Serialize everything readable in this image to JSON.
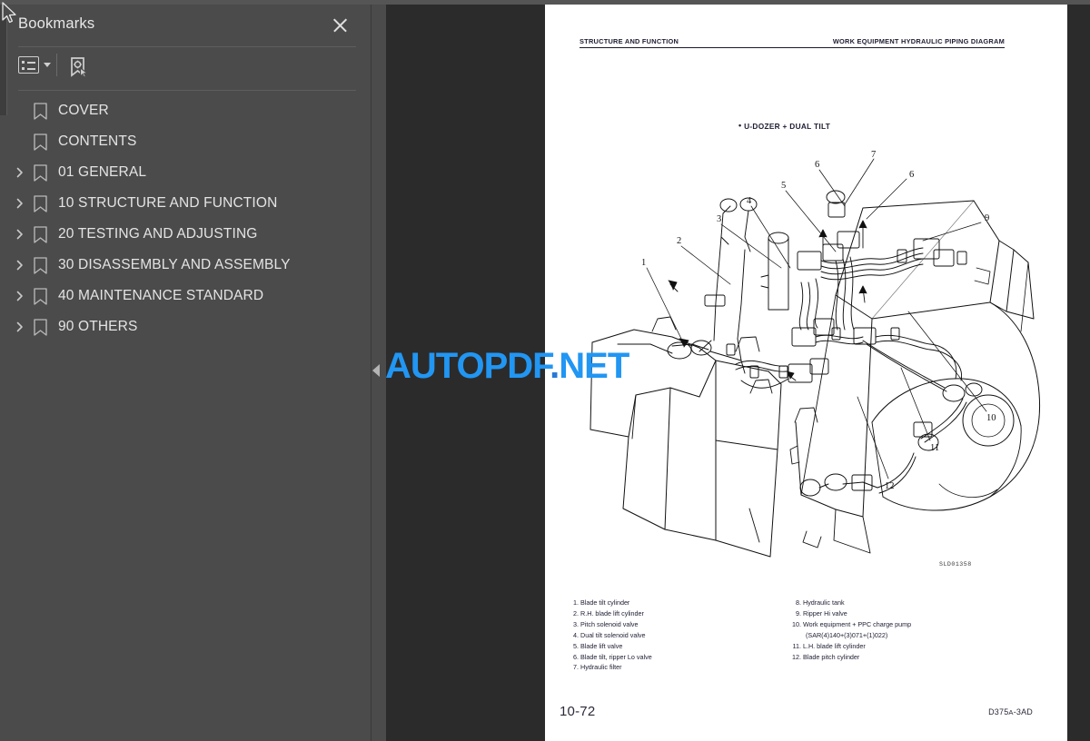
{
  "sidebar": {
    "title": "Bookmarks",
    "close_label": "×",
    "toolbar": {
      "options_label": "Bookmark options",
      "options_icon": "list-options-icon",
      "caret_icon": "chevron-down-icon",
      "new_bookmark_label": "New bookmark",
      "new_bookmark_icon": "new-bookmark-icon"
    },
    "items": [
      {
        "label": "COVER",
        "expandable": false
      },
      {
        "label": "CONTENTS",
        "expandable": false
      },
      {
        "label": "01 GENERAL",
        "expandable": true
      },
      {
        "label": "10 STRUCTURE AND FUNCTION",
        "expandable": true
      },
      {
        "label": "20 TESTING AND ADJUSTING",
        "expandable": true
      },
      {
        "label": "30 DISASSEMBLY AND ASSEMBLY",
        "expandable": true
      },
      {
        "label": "40 MAINTENANCE STANDARD",
        "expandable": true
      },
      {
        "label": "90 OTHERS",
        "expandable": true
      }
    ]
  },
  "splitter": {
    "collapse_icon": "collapse-left-arrow-icon"
  },
  "document": {
    "header_left": "STRUCTURE AND FUNCTION",
    "header_right": "WORK EQUIPMENT HYDRAULIC PIPING DIAGRAM",
    "subtitle_bullet": "•",
    "subtitle": "U-DOZER + DUAL TILT",
    "drawing_code": "SLD01358",
    "page_number": "10-72",
    "doc_code_main": "D375",
    "doc_code_mid": "A",
    "doc_code_end": "-3AD",
    "legend_left": [
      {
        "num": "1.",
        "text": "Blade tilt cylinder"
      },
      {
        "num": "2.",
        "text": "R.H. blade lift cylinder"
      },
      {
        "num": "3.",
        "text": "Pitch solenoid valve"
      },
      {
        "num": "4.",
        "text": "Dual tilt solenoid valve"
      },
      {
        "num": "5.",
        "text": "Blade lift valve"
      },
      {
        "num": "6.",
        "text": "Blade tilt, ripper Lo valve"
      },
      {
        "num": "7.",
        "text": "Hydraulic filter"
      }
    ],
    "legend_right": [
      {
        "num": "8.",
        "text": "Hydraulic tank"
      },
      {
        "num": "9.",
        "text": "Ripper Hi valve"
      },
      {
        "num": "10.",
        "text": "Work equipment + PPC charge pump",
        "sub": "(SAR(4)140+(3)071+(1)022)"
      },
      {
        "num": "11.",
        "text": "L.H. blade lift cylinder"
      },
      {
        "num": "12.",
        "text": "Blade pitch cylinder"
      }
    ],
    "callouts": [
      "1",
      "2",
      "3",
      "4",
      "5",
      "6",
      "7",
      "6",
      "9",
      "10",
      "11",
      "12"
    ]
  },
  "watermark": {
    "part_a": "AUTOPDF",
    "part_b": ".",
    "part_c": "NET"
  },
  "colors": {
    "sidebar_bg": "#4b4b4b",
    "viewer_bg": "#2b2b2b",
    "page_bg": "#ffffff",
    "text": "#e4e4e4",
    "watermark": "#2196f3",
    "doc_ink": "#1d1d33"
  }
}
